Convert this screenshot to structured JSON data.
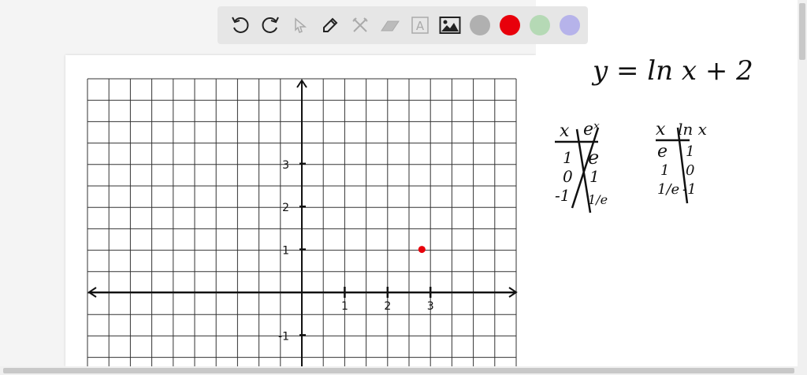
{
  "toolbar": {
    "tools": [
      "undo-icon",
      "redo-icon",
      "select-icon",
      "pen-icon",
      "tools-icon",
      "eraser-icon",
      "text-icon",
      "image-icon"
    ],
    "colors": [
      "#b0b0b0",
      "#e8000b",
      "#b5d9b5",
      "#b6b3ea"
    ]
  },
  "board": {
    "equation": "y = ln x + 2",
    "table1": {
      "header": [
        "x",
        "eˣ"
      ],
      "rows": [
        [
          "1",
          "e"
        ],
        [
          "0",
          "1"
        ],
        [
          "-1",
          "1/e"
        ]
      ]
    },
    "table2": {
      "header": [
        "x",
        "ln x"
      ],
      "rows": [
        [
          "e",
          "1"
        ],
        [
          "1",
          "0"
        ],
        [
          "1/e",
          "-1"
        ]
      ]
    },
    "x_ticks": [
      "1",
      "2",
      "3"
    ],
    "y_ticks": [
      "3",
      "2",
      "1",
      "-1"
    ],
    "point": {
      "x": 2.8,
      "y": 1,
      "color": "#e8000b"
    }
  }
}
